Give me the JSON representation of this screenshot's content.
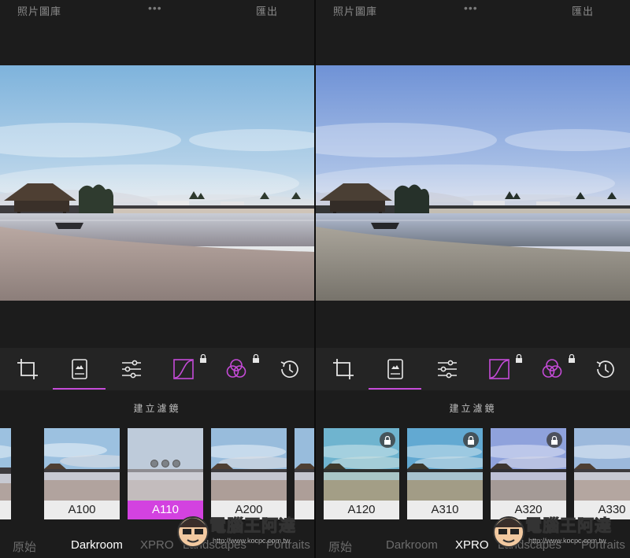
{
  "topbar": {
    "library": "照片圖庫",
    "more": "•••",
    "export": "匯出"
  },
  "sublabel": "建立濾鏡",
  "left_panel": {
    "filters": [
      {
        "name": "",
        "locked": false,
        "active": false,
        "tone": "warm"
      },
      {
        "name": "A100",
        "locked": false,
        "active": false,
        "tone": "warm"
      },
      {
        "name": "A110",
        "locked": false,
        "active": true,
        "tone": "processing"
      },
      {
        "name": "A200",
        "locked": false,
        "active": false,
        "tone": "warm"
      },
      {
        "name": "",
        "locked": false,
        "active": false,
        "tone": "warm"
      }
    ],
    "categories": [
      {
        "label": "原始",
        "active": false
      },
      {
        "label": "Darkroom",
        "active": true
      },
      {
        "label": "XPRO",
        "active": false
      },
      {
        "label": "Landscapes",
        "active": false
      },
      {
        "label": "Portraits",
        "active": false
      }
    ]
  },
  "right_panel": {
    "filters": [
      {
        "name": "A120",
        "locked": true,
        "active": false,
        "tone": "teal"
      },
      {
        "name": "A310",
        "locked": true,
        "active": false,
        "tone": "teal"
      },
      {
        "name": "A320",
        "locked": true,
        "active": false,
        "tone": "cool"
      },
      {
        "name": "A330",
        "locked": false,
        "active": false,
        "tone": "warm"
      }
    ],
    "categories": [
      {
        "label": "原始",
        "active": false
      },
      {
        "label": "Darkroom",
        "active": false
      },
      {
        "label": "XPRO",
        "active": true
      },
      {
        "label": "Landscapes",
        "active": false
      },
      {
        "label": "Portraits",
        "active": false
      }
    ]
  },
  "tools": [
    {
      "icon": "crop-icon",
      "locked": false,
      "active": false
    },
    {
      "icon": "filter-image-icon",
      "locked": false,
      "active": true
    },
    {
      "icon": "sliders-icon",
      "locked": false,
      "active": false
    },
    {
      "icon": "curves-icon",
      "locked": true,
      "active": false
    },
    {
      "icon": "color-circles-icon",
      "locked": true,
      "active": false
    },
    {
      "icon": "history-icon",
      "locked": false,
      "active": false
    }
  ],
  "watermark": {
    "text": "電腦王阿達",
    "url": "http://www.kocpc.com.tw"
  },
  "colors": {
    "accent": "#c54bd8",
    "active_label": "#d342e0",
    "panel_bg": "#1c1c1c",
    "toolbar_bg": "#242424"
  }
}
